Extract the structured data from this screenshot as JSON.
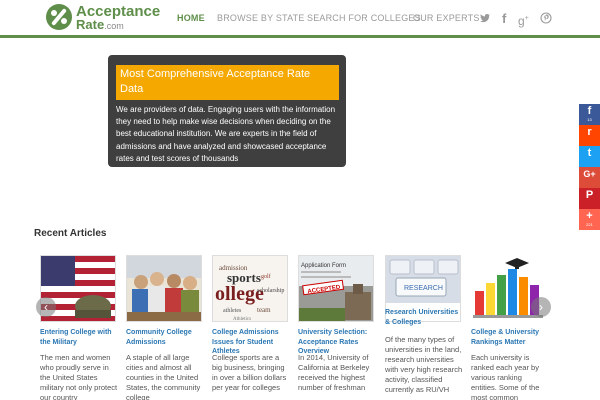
{
  "brand": {
    "name_line1": "Acceptance",
    "name_line2": "Rate",
    "tld": ".com"
  },
  "nav": {
    "items": [
      {
        "label": "HOME",
        "active": true
      },
      {
        "label": "BROWSE BY STATE",
        "active": false
      },
      {
        "label": "SEARCH FOR COLLEGES",
        "active": false
      },
      {
        "label": "OUR EXPERTS",
        "active": false
      }
    ],
    "social": [
      {
        "icon": "twitter-icon",
        "glyph": "t"
      },
      {
        "icon": "facebook-icon",
        "glyph": "f"
      },
      {
        "icon": "google-plus-icon",
        "glyph": "g+"
      },
      {
        "icon": "pinterest-icon",
        "glyph": "p"
      }
    ]
  },
  "hero": {
    "title": "Most Comprehensive Acceptance Rate Data",
    "text": "We are providers of data. Engaging users with the information they need to help make wise decisions when deciding on the best educational institution. We are experts in the field of admissions and have analyzed and showcased acceptance rates and test scores of thousands"
  },
  "share_bar": [
    {
      "icon": "facebook-icon",
      "glyph": "f",
      "count": "13",
      "color": "#3b5998"
    },
    {
      "icon": "reddit-icon",
      "glyph": "r",
      "count": "",
      "color": "#ff4500"
    },
    {
      "icon": "twitter-icon",
      "glyph": "t",
      "count": "",
      "color": "#1da1f2"
    },
    {
      "icon": "google-plus-icon",
      "glyph": "G+",
      "count": "",
      "color": "#dd4b39"
    },
    {
      "icon": "pinterest-icon",
      "glyph": "P",
      "count": "",
      "color": "#cb2027"
    },
    {
      "icon": "more-icon",
      "glyph": "+",
      "count": "221",
      "color": "#ff6550"
    }
  ],
  "recent": {
    "title": "Recent Articles",
    "articles": [
      {
        "title": "Entering College with the Military",
        "excerpt": "The men and women who proudly serve in the United States military not only protect our country",
        "image": "flag-and-helmet"
      },
      {
        "title": "Community College Admissions",
        "excerpt": "A staple of all large cities and almost all counties in the United States, the community college",
        "image": "students-group"
      },
      {
        "title": "College Admissions Issues for Student Athletes",
        "excerpt": "College sports are a big business, bringing in over a billion dollars per year for colleges",
        "image": "college-sports-word-cloud"
      },
      {
        "title": "University Selection: Acceptance Rates Overview",
        "excerpt": "In 2014, University of California at Berkeley received the highest number of freshman",
        "image": "application-form-accepted"
      },
      {
        "title": "Research Universities & Colleges",
        "excerpt": "Of the many types of universities in the land, research universities with very high research activity, classified currently as RU/VH",
        "image": "research-keyboard"
      },
      {
        "title": "College & University Rankings Matter",
        "excerpt": "Each university is ranked each year by various ranking entities.  Some of the most common",
        "image": "ranking-bar-chart"
      }
    ],
    "prev_glyph": "‹",
    "next_glyph": "›"
  },
  "colors": {
    "brand_green": "#5e8e4a",
    "hero_bg": "#3f3f3f",
    "hero_title_bg": "#f5a800",
    "link_blue": "#2b77b3"
  }
}
